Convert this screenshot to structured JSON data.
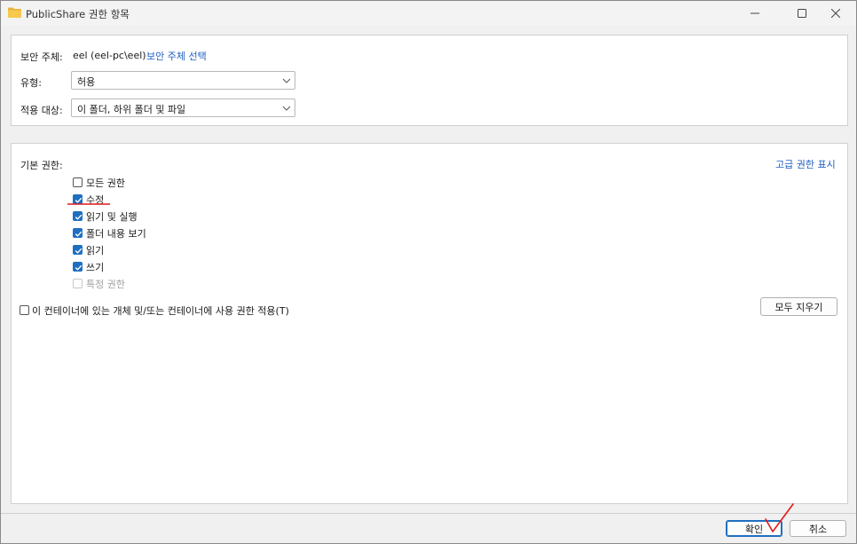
{
  "window": {
    "title": "PublicShare 권한 항목"
  },
  "principal": {
    "label": "보안 주체:",
    "value": "eel (eel-pc\\eel)",
    "select_link": "보안 주체 선택"
  },
  "type": {
    "label": "유형:",
    "value": "허용"
  },
  "applies_to": {
    "label": "적용 대상:",
    "value": "이 폴더, 하위 폴더 및 파일"
  },
  "basic_permissions": {
    "label": "기본 권한:",
    "advanced_link": "고급 권한 표시",
    "items": [
      {
        "label": "모든 권한",
        "checked": false,
        "disabled": false
      },
      {
        "label": "수정",
        "checked": true,
        "disabled": false
      },
      {
        "label": "읽기 및 실행",
        "checked": true,
        "disabled": false
      },
      {
        "label": "폴더 내용 보기",
        "checked": true,
        "disabled": false
      },
      {
        "label": "읽기",
        "checked": true,
        "disabled": false
      },
      {
        "label": "쓰기",
        "checked": true,
        "disabled": false
      },
      {
        "label": "특정 권한",
        "checked": false,
        "disabled": true
      }
    ]
  },
  "apply_container": {
    "label": "이 컨테이너에 있는 개체 및/또는 컨테이너에 사용 권한 적용(T)",
    "checked": false
  },
  "clear_all_label": "모두 지우기",
  "footer": {
    "ok_label": "확인",
    "cancel_label": "취소"
  },
  "colors": {
    "accent": "#1f6fc1",
    "link": "#1f5fbf",
    "annotation": "#e0191b"
  },
  "icons": {
    "title": "folder-icon",
    "minimize": "minimize-icon",
    "maximize": "maximize-icon",
    "close": "close-icon",
    "dropdown": "chevron-down-icon",
    "check": "check-icon"
  }
}
